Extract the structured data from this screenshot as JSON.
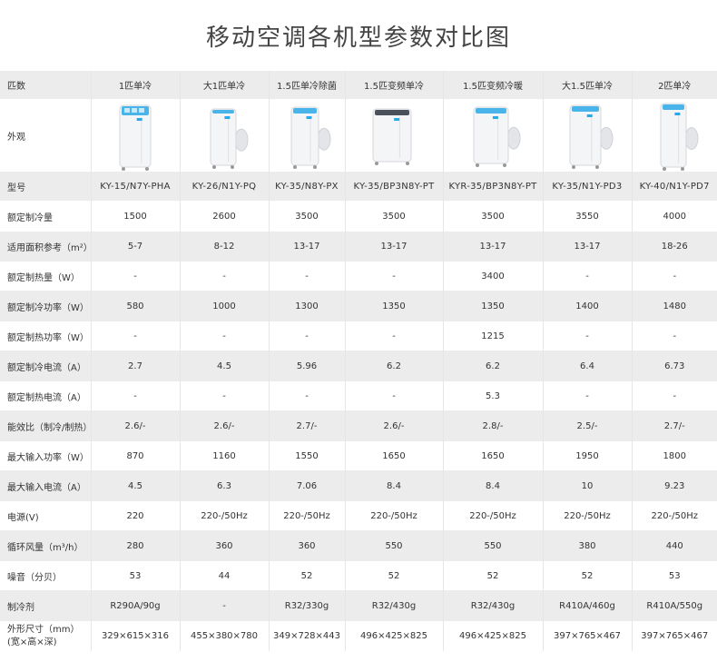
{
  "title": "移动空调各机型参数对比图",
  "header_label": "匹数",
  "appearance_label": "外观",
  "models": [
    {
      "hp": "1匹单冷",
      "variant": "a"
    },
    {
      "hp": "大1匹单冷",
      "variant": "b"
    },
    {
      "hp": "1.5匹单冷除菌",
      "variant": "c"
    },
    {
      "hp": "1.5匹变频单冷",
      "variant": "d"
    },
    {
      "hp": "1.5匹变频冷暖",
      "variant": "e"
    },
    {
      "hp": "大1.5匹单冷",
      "variant": "f"
    },
    {
      "hp": "2匹单冷",
      "variant": "g"
    }
  ],
  "rows": [
    {
      "label": "型号",
      "values": [
        "KY-15/N7Y-PHA",
        "KY-26/N1Y-PQ",
        "KY-35/N8Y-PX",
        "KY-35/BP3N8Y-PT",
        "KYR-35/BP3N8Y-PT",
        "KY-35/N1Y-PD3",
        "KY-40/N1Y-PD7"
      ]
    },
    {
      "label": "额定制冷量",
      "values": [
        "1500",
        "2600",
        "3500",
        "3500",
        "3500",
        "3550",
        "4000"
      ]
    },
    {
      "label": "适用面积参考（m²）",
      "values": [
        "5-7",
        "8-12",
        "13-17",
        "13-17",
        "13-17",
        "13-17",
        "18-26"
      ]
    },
    {
      "label": "额定制热量（W）",
      "values": [
        "-",
        "-",
        "-",
        "-",
        "3400",
        "-",
        "-"
      ]
    },
    {
      "label": "额定制冷功率（W）",
      "values": [
        "580",
        "1000",
        "1300",
        "1350",
        "1350",
        "1400",
        "1480"
      ]
    },
    {
      "label": "额定制热功率（W）",
      "values": [
        "-",
        "-",
        "-",
        "-",
        "1215",
        "-",
        "-"
      ]
    },
    {
      "label": "额定制冷电流（A）",
      "values": [
        "2.7",
        "4.5",
        "5.96",
        "6.2",
        "6.2",
        "6.4",
        "6.73"
      ]
    },
    {
      "label": "额定制热电流（A）",
      "values": [
        "-",
        "-",
        "-",
        "-",
        "5.3",
        "-",
        "-"
      ]
    },
    {
      "label": "能效比（制冷/制热）",
      "values": [
        "2.6/-",
        "2.6/-",
        "2.7/-",
        "2.6/-",
        "2.8/-",
        "2.5/-",
        "2.7/-"
      ]
    },
    {
      "label": "最大输入功率（W）",
      "values": [
        "870",
        "1160",
        "1550",
        "1650",
        "1650",
        "1950",
        "1800"
      ]
    },
    {
      "label": "最大输入电流（A）",
      "values": [
        "4.5",
        "6.3",
        "7.06",
        "8.4",
        "8.4",
        "10",
        "9.23"
      ]
    },
    {
      "label": "电源(V)",
      "values": [
        "220",
        "220-/50Hz",
        "220-/50Hz",
        "220-/50Hz",
        "220-/50Hz",
        "220-/50Hz",
        "220-/50Hz"
      ]
    },
    {
      "label": "循环风量（m³/h）",
      "values": [
        "280",
        "360",
        "360",
        "550",
        "550",
        "380",
        "440"
      ]
    },
    {
      "label": "噪音（分贝）",
      "values": [
        "53",
        "44",
        "52",
        "52",
        "52",
        "52",
        "53"
      ]
    },
    {
      "label": "制冷剂",
      "values": [
        "R290A/90g",
        "-",
        "R32/330g",
        "R32/430g",
        "R32/430g",
        "R410A/460g",
        "R410A/550g"
      ]
    },
    {
      "label": "外形尺寸（mm）\n(宽×高×深)",
      "values": [
        "329×615×316",
        "455×380×780",
        "349×728×443",
        "496×425×825",
        "496×425×825",
        "397×765×467",
        "397×765×467"
      ]
    }
  ],
  "colors": {
    "stripe": "#ececec",
    "accent_blue": "#2aa8e8",
    "unit_body": "#f4f5f7"
  }
}
